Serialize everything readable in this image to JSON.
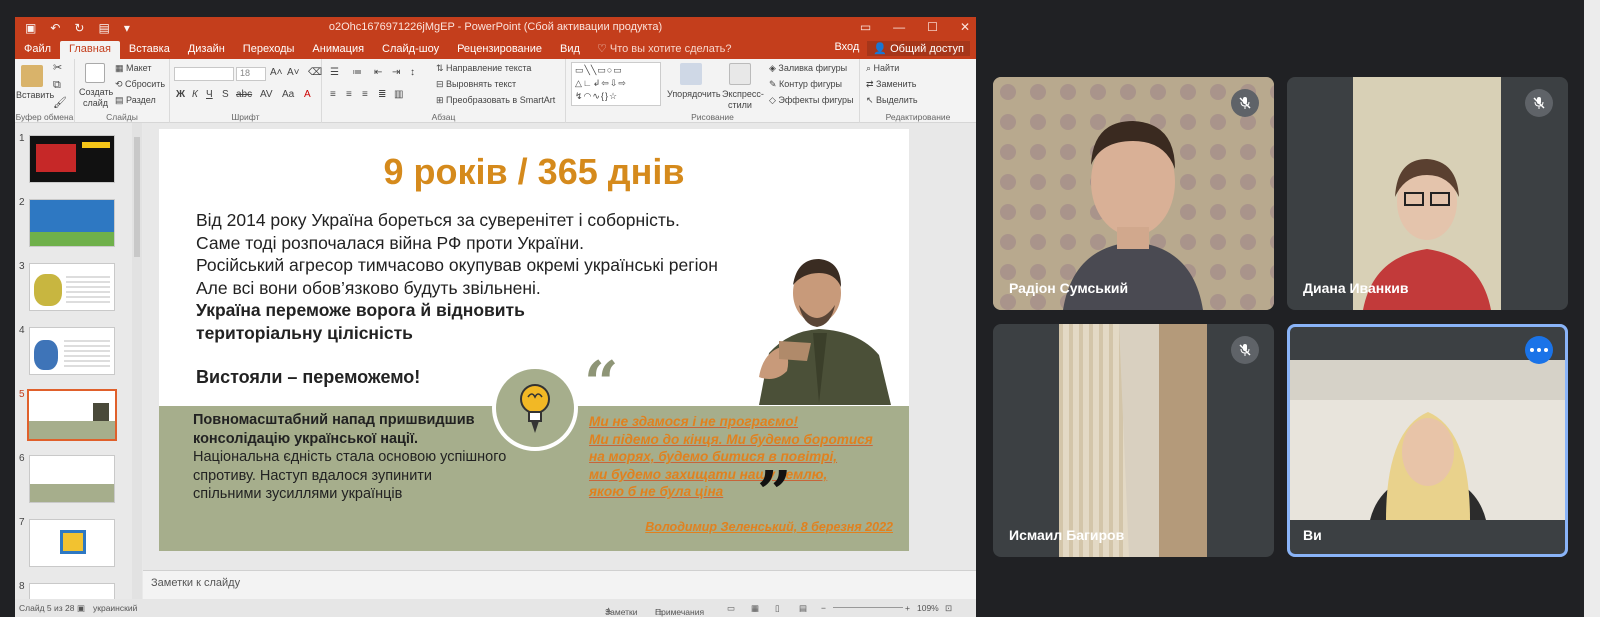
{
  "powerpoint": {
    "window_title": "o2Ohc1676971226jMgEP - PowerPoint (Сбой активации продукта)",
    "tabs": [
      "Файл",
      "Главная",
      "Вставка",
      "Дизайн",
      "Переходы",
      "Анимация",
      "Слайд-шоу",
      "Рецензирование",
      "Вид"
    ],
    "active_tab": "Главная",
    "tell_me": "Что вы хотите сделать?",
    "sign_in": "Вход",
    "share": "Общий доступ",
    "ribbon": {
      "paste": "Вставить",
      "new_slide_line1": "Создать",
      "new_slide_line2": "слайд",
      "layout": "Макет",
      "reset": "Сбросить",
      "section": "Раздел",
      "font_size": "18",
      "text_direction": "Направление текста",
      "align_text": "Выровнять текст",
      "smartart": "Преобразовать в SmartArt",
      "arrange": "Упорядочить",
      "quick_styles_line1": "Экспресс-",
      "quick_styles_line2": "стили",
      "shape_fill": "Заливка фигуры",
      "shape_outline": "Контур фигуры",
      "shape_effects": "Эффекты фигуры",
      "find": "Найти",
      "replace": "Заменить",
      "select": "Выделить",
      "groups": {
        "clipboard": "Буфер обмена",
        "slides": "Слайды",
        "font": "Шрифт",
        "paragraph": "Абзац",
        "drawing": "Рисование",
        "editing": "Редактирование"
      }
    },
    "thumbnails": [
      {
        "num": "1"
      },
      {
        "num": "2"
      },
      {
        "num": "3"
      },
      {
        "num": "4"
      },
      {
        "num": "5"
      },
      {
        "num": "6"
      },
      {
        "num": "7"
      },
      {
        "num": "8"
      }
    ],
    "slide": {
      "title": "9 років / 365 днів",
      "body_lines": [
        "Від 2014 року Україна бореться за суверенітет і соборність.",
        "Саме тоді розпочалася війна РФ проти України.",
        "Російський агресор тимчасово окупував окремі українські регіони.",
        "Але всі вони обов’язково будуть звільнені."
      ],
      "bold_lines": [
        "Україна переможе ворога й відновить",
        "територіальну цілісність"
      ],
      "slogan": "Вистояли – переможемо!",
      "band_bold": [
        "Повномасштабний напад пришвидшив",
        "консолідацію української нації."
      ],
      "band_lines": [
        "Національна єдність стала основою успішного",
        "спротиву. Наступ вдалося зупинити",
        " спільними зусиллями українців"
      ],
      "quote_lines": [
        "Ми не здамося і не програємо!",
        "Ми підемо до кінця. Ми будемо боротися",
        "на морях, будемо битися в повітрі,",
        "ми будемо захищати нашу землю,",
        "якою б не була ціна"
      ],
      "quote_open": "“",
      "quote_close": "”",
      "attribution": "Володимир Зеленський, 8 березня 2022"
    },
    "notes_placeholder": "Заметки к слайду",
    "status": {
      "slide_info": "Слайд 5 из 28",
      "language": "украинский",
      "notes": "Заметки",
      "comments": "Примечания",
      "zoom": "109%"
    }
  },
  "meet": {
    "participants": [
      {
        "name": "Радіон Сумський",
        "muted": true
      },
      {
        "name": "Диана Иванкив",
        "muted": true
      },
      {
        "name": "Исмаил Багиров",
        "muted": true
      },
      {
        "name": "Ви",
        "muted": false
      }
    ]
  }
}
